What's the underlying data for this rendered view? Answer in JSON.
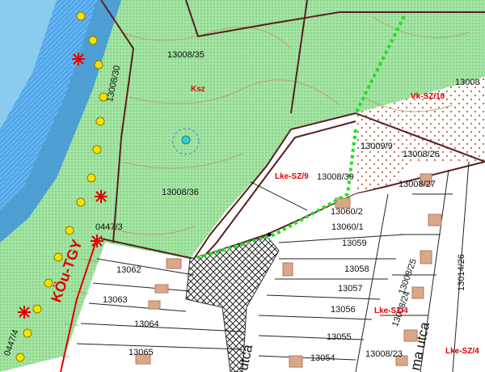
{
  "map": {
    "parcels": [
      "13008/35",
      "13008/30",
      "13008",
      "13008/36",
      "13008/39",
      "13009/9",
      "13008/26",
      "13008/27",
      "13060/2",
      "13060/1",
      "13059",
      "13062",
      "13058",
      "13063",
      "13057",
      "13064",
      "13056",
      "13055",
      "13065",
      "13054",
      "13008/25",
      "13008/24",
      "13008/23",
      "13014/26",
      "0447/3",
      "0447/4"
    ],
    "zones": [
      "Ksz",
      "Vk-SZ/10",
      "Lke-SZ/9",
      "Lke-SZ/4",
      "Lke-SZ/4"
    ],
    "zone_big": "KÖu-TGY",
    "streets": [
      "ma utca",
      "utca"
    ]
  },
  "colors": {
    "green_zone": "#9ee09e",
    "green_dot": "#74c874",
    "blue_river": "#3a8fe0",
    "blue_dark": "#1f66b8",
    "parcel_line": "#5a1e1e",
    "contour": "#c89060",
    "red": "#e00000",
    "dotted_green": "#22dd22",
    "building": "#d9a88a",
    "yellow": "#f4e400",
    "white_bg": "#ffffff"
  }
}
